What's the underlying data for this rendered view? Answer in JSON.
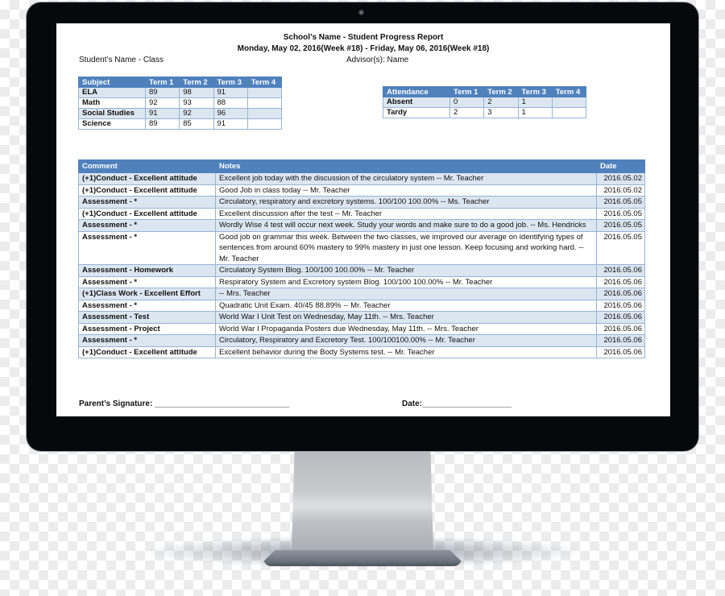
{
  "report": {
    "title": "School’s Name - Student Progress Report",
    "date_range": "Monday, May 02, 2016(Week #18) - Friday, May 06, 2016(Week #18)",
    "student": "Student’s Name - Class",
    "advisor": "Advisor(s): Name"
  },
  "grades": {
    "headers": [
      "Subject",
      "Term 1",
      "Term 2",
      "Term 3",
      "Term 4"
    ],
    "rows": [
      [
        "ELA",
        "89",
        "98",
        "91",
        ""
      ],
      [
        "Math",
        "92",
        "93",
        "88",
        ""
      ],
      [
        "Social Studies",
        "91",
        "92",
        "96",
        ""
      ],
      [
        "Science",
        "89",
        "85",
        "91",
        ""
      ]
    ]
  },
  "attendance": {
    "headers": [
      "Attendance",
      "Term 1",
      "Term 2",
      "Term 3",
      "Term 4"
    ],
    "rows": [
      [
        "Absent",
        "0",
        "2",
        "1",
        ""
      ],
      [
        "Tardy",
        "2",
        "3",
        "1",
        ""
      ]
    ]
  },
  "comments": {
    "headers": [
      "Comment",
      "Notes",
      "Date"
    ],
    "rows": [
      [
        "(+1)Conduct - Excellent attitude",
        "Excellent job today with the discussion of the circulatory system -- Mr. Teacher",
        "2016.05.02"
      ],
      [
        "(+1)Conduct - Excellent attitude",
        "Good Job in class today -- Mr. Teacher",
        "2016.05.02"
      ],
      [
        "Assessment - *",
        "Circulatory, respiratory and excretory systems. 100/100 100.00% -- Ms. Teacher",
        "2016.05.05"
      ],
      [
        "(+1)Conduct - Excellent attitude",
        "Excellent discussion after the test -- Mr. Teacher",
        "2016.05.05"
      ],
      [
        "Assessment - *",
        "Wordly Wise 4 test will occur next week.  Study your words and make sure to do a good job. -- Ms. Hendricks",
        "2016.05.05"
      ],
      [
        "Assessment - *",
        "Good job on grammar this week.  Between the two classes, we improved our average on identifying types of sentences from around 60% mastery to 99% mastery in just one lesson.  Keep focusing and working hard. -- Mr. Teacher",
        "2016.05.05"
      ],
      [
        "Assessment - Homework",
        "Circulatory System Blog. 100/100 100.00% -- Mr. Teacher",
        "2016.05.06"
      ],
      [
        "Assessment - *",
        "Respiratory System and Excretory system Blog. 100/100 100.00% -- Mr. Teacher",
        "2016.05.06"
      ],
      [
        "(+1)Class Work - Excellent Effort",
        " -- Mrs. Teacher",
        "2016.05.06"
      ],
      [
        "Assessment - *",
        "Quadratic Unit Exam. 40/45 88.89% -- Mr. Teacher",
        "2016.05.06"
      ],
      [
        "Assessment - Test",
        "World War I Unit Test on Wednesday, May 11th. -- Mrs. Teacher",
        "2016.05.06"
      ],
      [
        "Assessment - Project",
        "World War I Propaganda Posters due Wednesday, May 11th. -- Mrs. Teacher",
        "2016.05.06"
      ],
      [
        "Assessment - *",
        "Circulatory, Respiratory and Excretory Test. 100/100100.00% -- Mr. Teacher",
        "2016.05.06"
      ],
      [
        "(+1)Conduct - Excellent attitude",
        "Excellent behavior during the Body Systems test. -- Mr. Teacher",
        "2016.05.06"
      ]
    ]
  },
  "signature": {
    "parent_label": "Parent’s Signature: ______________________________",
    "date_label": "Date:____________________"
  },
  "colors": {
    "header_blue": "#4f81bd",
    "band_blue": "#dce6f1",
    "border_blue": "#95b3d7",
    "bezel": "#07080c"
  }
}
